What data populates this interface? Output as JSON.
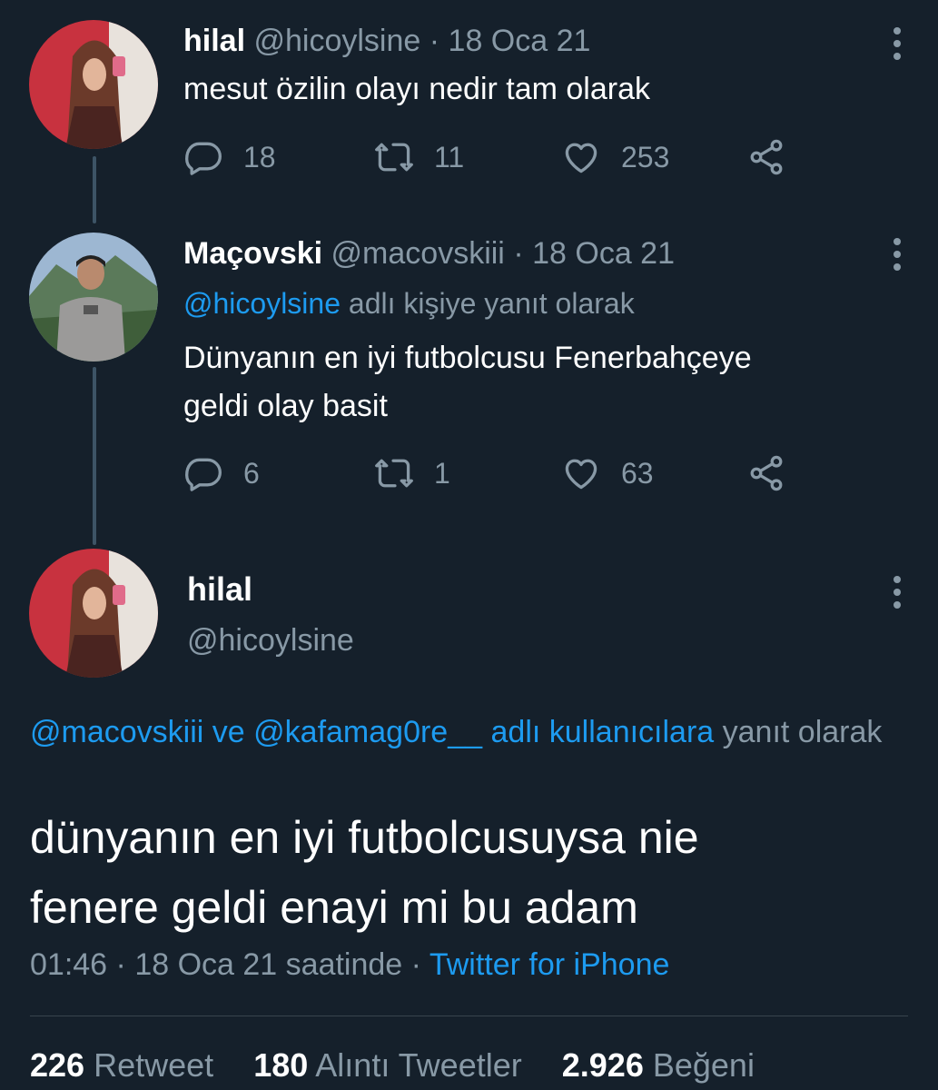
{
  "tweet1": {
    "name": "hilal",
    "handle": "@hicoylsine",
    "date": "18 Oca 21",
    "text": "mesut özilin olayı nedir tam olarak",
    "replies": "18",
    "retweets": "11",
    "likes": "253"
  },
  "tweet2": {
    "name": "Maçovski",
    "handle": "@macovskiii",
    "date": "18 Oca 21",
    "reply_to": "@hicoylsine",
    "reply_suffix": "adlı kişiye yanıt olarak",
    "text_line1": "Dünyanın en iyi futbolcusu Fenerbahçeye",
    "text_line2": "geldi olay basit",
    "replies": "6",
    "retweets": "1",
    "likes": "63"
  },
  "main_tweet": {
    "name": "hilal",
    "handle": "@hicoylsine",
    "reply_link1": "@macovskiii",
    "reply_and": "ve",
    "reply_link2": "@kafamag0re__",
    "reply_link3": "adlı kullanıcılara",
    "reply_suffix": "yanıt olarak",
    "text_line1": "dünyanın en iyi futbolcusuysa nie",
    "text_line2": "fenere geldi enayi mi bu adam",
    "time": "01:46",
    "date": "18 Oca 21 saatinde",
    "separator": "·",
    "source": "Twitter for iPhone",
    "retweet_count": "226",
    "retweet_label": "Retweet",
    "quote_count": "180",
    "quote_label": "Alıntı Tweetler",
    "like_count": "2.926",
    "like_label": "Beğeni"
  },
  "separator": "·",
  "colors": {
    "background": "#15202b",
    "text": "#ffffff",
    "secondary": "#8899a6",
    "link": "#1d9bf0",
    "thread_line": "#3d5466"
  },
  "icons": [
    "reply-icon",
    "retweet-icon",
    "like-icon",
    "share-icon",
    "more-icon"
  ]
}
